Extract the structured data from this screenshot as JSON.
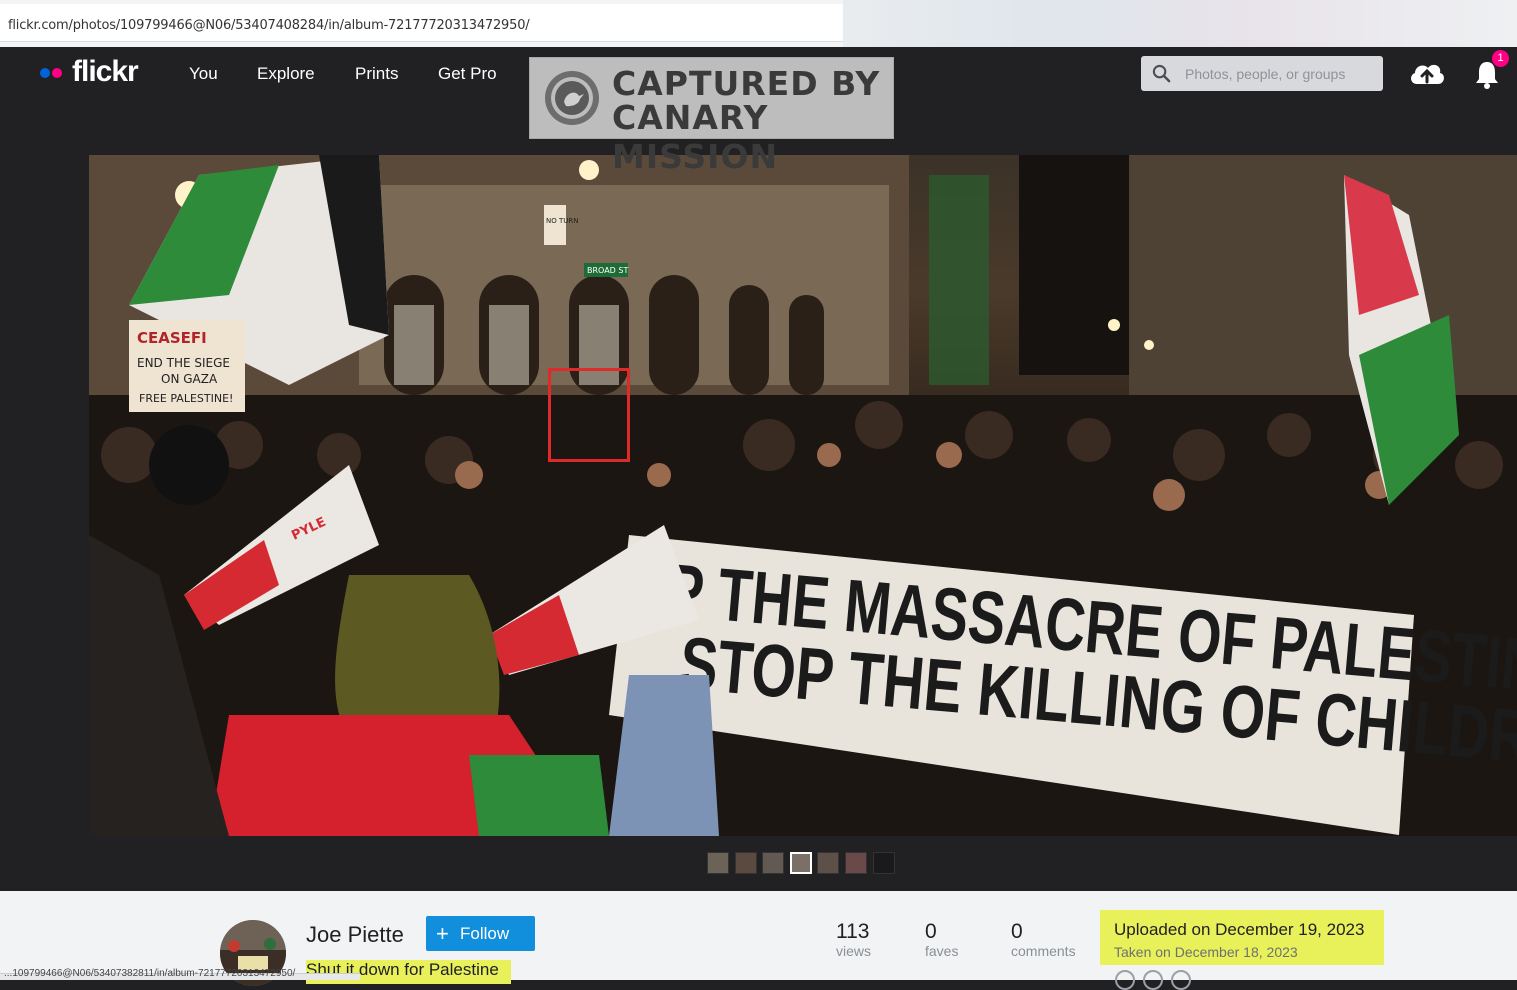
{
  "browser": {
    "url": "flickr.com/photos/109799466@N06/53407408284/in/album-72177720313472950/",
    "status_url": "...109799466@N06/53407382811/in/album-72177720313472950/"
  },
  "header": {
    "logo": "flickr",
    "nav": [
      "You",
      "Explore",
      "Prints",
      "Get Pro"
    ],
    "search_placeholder": "Photos, people, or groups",
    "notification_count": "1"
  },
  "watermark": {
    "line1": "CAPTURED BY",
    "line2": "CANARY MISSION"
  },
  "photo": {
    "banner_line1": "P THE MASSACRE OF PALESTINIANS",
    "banner_line2": "STOP THE KILLING OF CHILDREN",
    "sign_line1": "CEASEFI",
    "sign_line2": "END THE SIEGE",
    "sign_line3": "ON GAZA",
    "sign_line4": "FREE PALESTINE!",
    "street_sign": "BROAD ST",
    "no_turn_sign": "NO TURN",
    "megaphone_brand": "PYLE"
  },
  "info": {
    "author": "Joe Piette",
    "follow_label": "Follow",
    "album_title": "Shut it down for Palestine",
    "stats": [
      {
        "value": "113",
        "label": "views"
      },
      {
        "value": "0",
        "label": "faves"
      },
      {
        "value": "0",
        "label": "comments"
      }
    ],
    "uploaded": "Uploaded on December 19, 2023",
    "taken": "Taken on December 18, 2023"
  },
  "colors": {
    "header_bg": "#212124",
    "follow_blue": "#128fdc",
    "highlight": "#e8f05a",
    "flickr_blue": "#0063dc",
    "flickr_pink": "#ff0084",
    "highlight_box": "#e02a2a"
  }
}
